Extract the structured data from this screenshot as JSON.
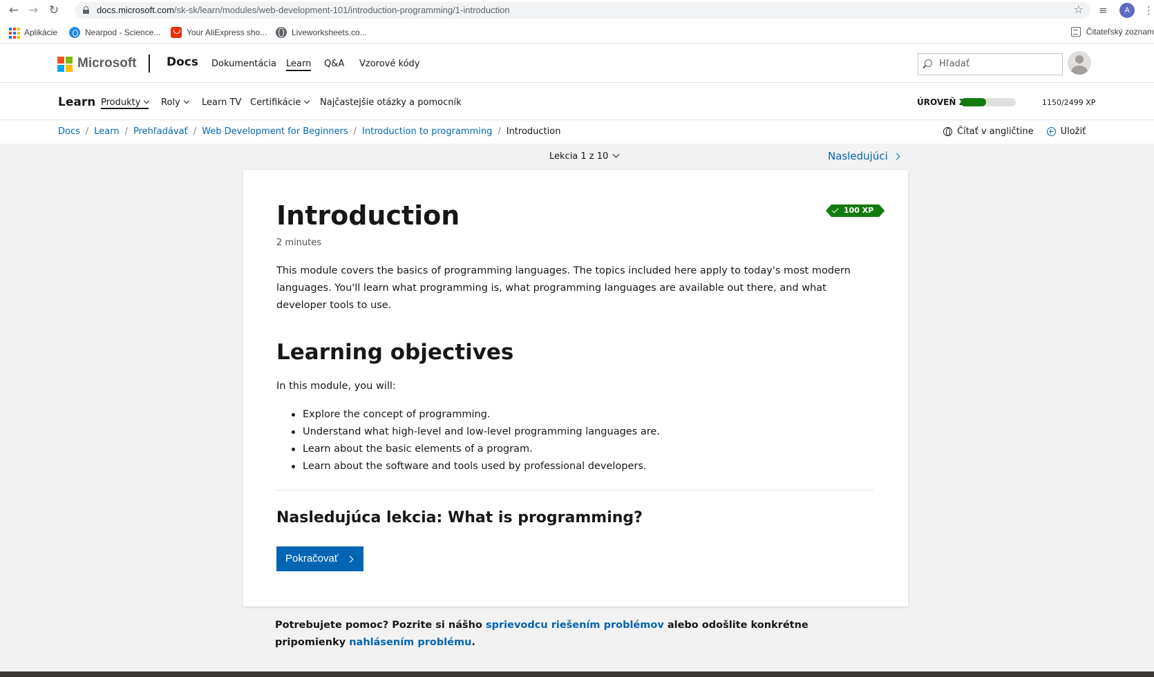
{
  "browser": {
    "url_host": "docs.microsoft.com",
    "url_path": "/sk-sk/learn/modules/web-development-101/introduction-programming/1-introduction",
    "profile_initial": "A",
    "bookmarks": [
      {
        "label": "Aplikácie",
        "icon": "apps-grid-icon"
      },
      {
        "label": "Nearpod - Science...",
        "icon": "nearpod-icon"
      },
      {
        "label": "Your AliExpress sho...",
        "icon": "aliexpress-icon"
      },
      {
        "label": "Liveworksheets.co...",
        "icon": "globe-icon"
      }
    ],
    "reading_list": "Čitateľský zoznam"
  },
  "header": {
    "brand": "Microsoft",
    "product": "Docs",
    "nav": [
      "Dokumentácia",
      "Learn",
      "Q&A",
      "Vzorové kódy"
    ],
    "active_nav": "Learn",
    "search_placeholder": "Hľadať"
  },
  "learn_nav": {
    "title": "Learn",
    "items": [
      "Produkty",
      "Roly",
      "Learn TV",
      "Certifikácie",
      "Najčastejšie otázky a pomocník"
    ],
    "level_label": "ÚROVEŇ 2",
    "xp_text": "1150/2499 XP",
    "xp_progress": 0.46,
    "accent": "#107c10"
  },
  "breadcrumb": {
    "items": [
      "Docs",
      "Learn",
      "Prehľadávať",
      "Web Development for Beginners",
      "Introduction to programming"
    ],
    "current": "Introduction",
    "read_english": "Čítať v angličtine",
    "save": "Uložiť"
  },
  "lesson": {
    "counter": "Lekcia 1 z 10",
    "next": "Nasledujúci",
    "xp_badge": "100 XP",
    "title": "Introduction",
    "duration": "2 minutes",
    "intro": "This module covers the basics of programming languages. The topics included here apply to today's most modern languages. You'll learn what programming is, what programming languages are available out there, and what developer tools to use.",
    "objectives_title": "Learning objectives",
    "objectives_lead": "In this module, you will:",
    "objectives": [
      "Explore the concept of programming.",
      "Understand what high-level and low-level programming languages are.",
      "Learn about the basic elements of a program.",
      "Learn about the software and tools used by professional developers."
    ],
    "next_lesson_title": "Nasledujúca lekcia: What is programming?",
    "continue_label": "Pokračovať"
  },
  "help": {
    "text_1": "Potrebujete pomoc? Pozrite si nášho ",
    "link_1": "sprievodcu riešením problémov",
    "text_2": " alebo odošlite konkrétne pripomienky ",
    "link_2": "nahlásením problému",
    "text_3": "."
  },
  "colors": {
    "link": "#0065b3",
    "ms_red": "#f25022",
    "ms_green": "#7fba00",
    "ms_blue": "#00a4ef",
    "ms_yellow": "#ffb900"
  }
}
